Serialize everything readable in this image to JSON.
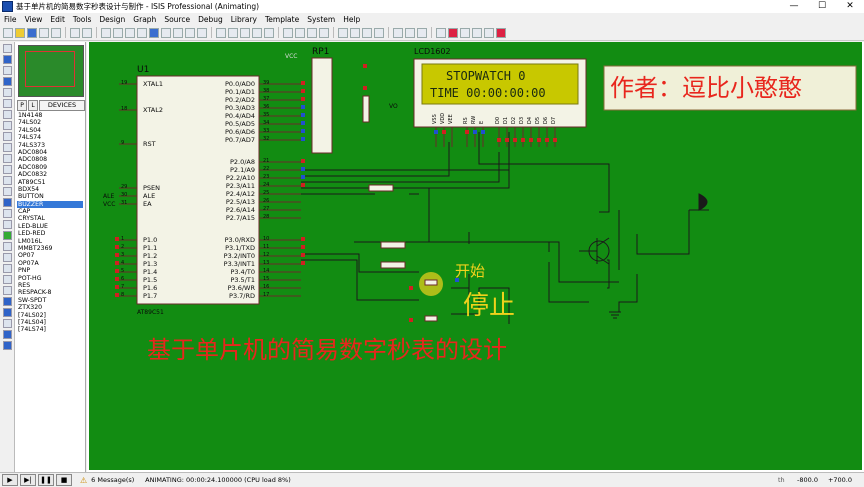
{
  "window": {
    "title": "基于单片机的简易数字秒表设计与制作 - ISIS Professional (Animating)",
    "min": "—",
    "max": "☐",
    "close": "✕"
  },
  "menu": [
    "File",
    "View",
    "Edit",
    "Tools",
    "Design",
    "Graph",
    "Source",
    "Debug",
    "Library",
    "Template",
    "System",
    "Help"
  ],
  "panel": {
    "tab_p": "P",
    "tab_l": "L",
    "tab_devices": "DEVICES",
    "devices": [
      "1N4148",
      "74LS02",
      "74LS04",
      "74LS74",
      "74LS373",
      "ADC0804",
      "ADC0808",
      "ADC0809",
      "ADC0832",
      "AT89C51",
      "BDX54",
      "BUTTON",
      "BUZZER",
      "CAP",
      "CRYSTAL",
      "LED-BLUE",
      "LED-RED",
      "LM016L",
      "MMBT2369",
      "OP07",
      "OP07A",
      "PNP",
      "POT-HG",
      "RES",
      "RESPACK-8",
      "SW-SPDT",
      "ZTX320",
      "[74LS02]",
      "[74LS04]",
      "[74LS74]"
    ],
    "selected_index": 12
  },
  "schematic": {
    "u1_label": "U1",
    "chip_name": "AT89C51",
    "left_pins": [
      "XTAL1",
      "XTAL2",
      "RST",
      "PSEN",
      "ALE",
      "EA",
      "P1.0",
      "P1.1",
      "P1.2",
      "P1.3",
      "P1.4",
      "P1.5",
      "P1.6",
      "P1.7"
    ],
    "left_pin_nums": [
      "19",
      "18",
      "9",
      "29",
      "30",
      "31",
      "1",
      "2",
      "3",
      "4",
      "5",
      "6",
      "7",
      "8"
    ],
    "right_pins": [
      "P0.0/AD0",
      "P0.1/AD1",
      "P0.2/AD2",
      "P0.3/AD3",
      "P0.4/AD4",
      "P0.5/AD5",
      "P0.6/AD6",
      "P0.7/AD7",
      "P2.0/A8",
      "P2.1/A9",
      "P2.2/A10",
      "P2.3/A11",
      "P2.4/A12",
      "P2.5/A13",
      "P2.6/A14",
      "P2.7/A15",
      "P3.0/RXD",
      "P3.1/TXD",
      "P3.2/INT0",
      "P3.3/INT1",
      "P3.4/T0",
      "P3.5/T1",
      "P3.6/WR",
      "P3.7/RD"
    ],
    "right_pin_nums": [
      "39",
      "38",
      "37",
      "36",
      "35",
      "34",
      "33",
      "32",
      "21",
      "22",
      "23",
      "24",
      "25",
      "26",
      "27",
      "28",
      "10",
      "11",
      "12",
      "13",
      "14",
      "15",
      "16",
      "17"
    ],
    "alt_labels": [
      "ALE",
      "VCC"
    ],
    "rp1_label": "RP1",
    "lcd_label": "LCD1602",
    "lcd_line1": "STOPWATCH  0",
    "lcd_line2": "TIME 00:00:00:00",
    "lcd_pins": [
      "VSS",
      "VDD",
      "VEE",
      "RS",
      "RW",
      "E",
      "D0",
      "D1",
      "D2",
      "D3",
      "D4",
      "D5",
      "D6",
      "D7"
    ],
    "vcc_label": "VCC",
    "vo_label": "VO",
    "author": "作者：逗比小憨憨",
    "start_label": "开始",
    "stop_label": "停止",
    "main_title": "基于单片机的简易数字秒表的设计"
  },
  "status": {
    "messages": "6 Message(s)",
    "animating": "ANIMATING: 00:00:24.100000 (CPU load 8%)",
    "coord_x": "-800.0",
    "coord_y": "+700.0",
    "th": "th"
  },
  "colors": {
    "sheet": "#128c12",
    "lcd_bg": "#c8c800",
    "lcd_text": "#1a2a10",
    "title_red": "#e8261d",
    "label_yellow": "#f0d21c",
    "author_bg": "#f0f0d8"
  }
}
